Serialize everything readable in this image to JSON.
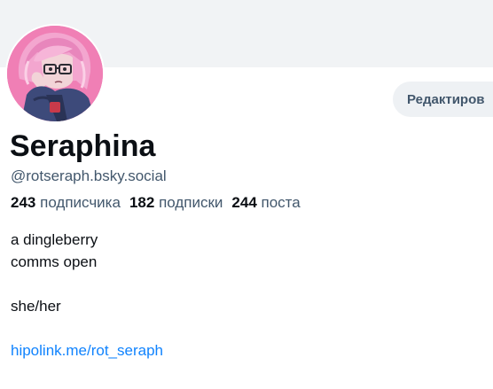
{
  "profile": {
    "display_name": "Seraphina",
    "handle": "@rotseraph.bsky.social",
    "avatar_icon": "avatar-illustration",
    "banner_color": "#f1f3f5"
  },
  "actions": {
    "edit_label": "Редактиров"
  },
  "stats": {
    "followers_count": "243",
    "followers_label": "подписчика",
    "following_count": "182",
    "following_label": "подписки",
    "posts_count": "244",
    "posts_label": "поста"
  },
  "bio": {
    "lines": [
      "a dingleberry",
      "comms open",
      "",
      "she/her",
      ""
    ],
    "link": "hipolink.me/rot_seraph"
  },
  "colors": {
    "text_primary": "#0b0f14",
    "text_secondary": "#42576c",
    "link": "#1083fe",
    "button_bg": "#eef1f4"
  }
}
